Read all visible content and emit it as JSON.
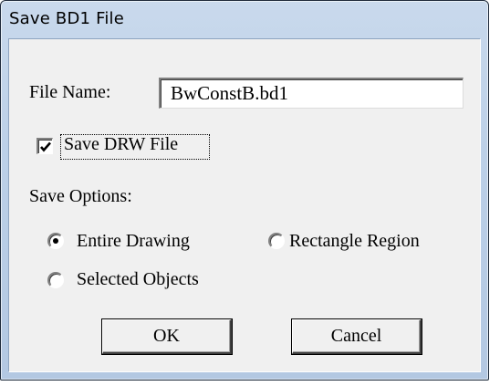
{
  "window": {
    "title": "Save BD1 File"
  },
  "file_name": {
    "label": "File Name:",
    "value": "BwConstB.bd1"
  },
  "save_drw": {
    "label": "Save DRW File",
    "checked": true
  },
  "save_options": {
    "label": "Save Options:",
    "options": [
      {
        "label": "Entire Drawing",
        "selected": true
      },
      {
        "label": "Rectangle Region",
        "selected": false
      },
      {
        "label": "Selected Objects",
        "selected": false
      }
    ]
  },
  "buttons": {
    "ok": "OK",
    "cancel": "Cancel"
  }
}
